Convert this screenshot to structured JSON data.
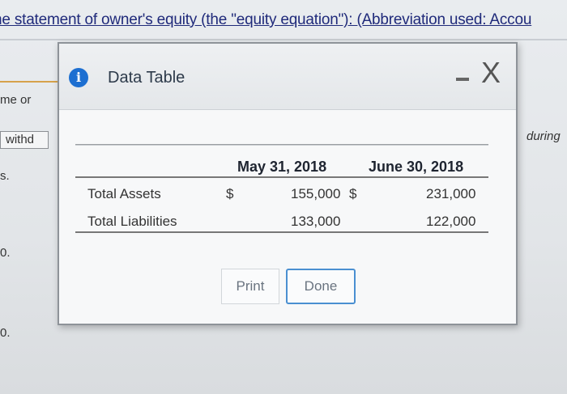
{
  "background": {
    "heading": "he statement of owner's equity (the \"equity equation\"): (Abbreviation used: Accou",
    "fragments": [
      "me or",
      "withd",
      "s.",
      "0.",
      "0."
    ],
    "right_fragment": "during"
  },
  "dialog": {
    "title": "Data Table",
    "info_icon": "i",
    "minimize_label": "-",
    "close_label": "X",
    "table": {
      "columns": [
        "May 31, 2018",
        "June 30, 2018"
      ],
      "rows": [
        {
          "label": "Total Assets",
          "c1_prefix": "$",
          "c1_value": "155,000",
          "c2_prefix": "$",
          "c2_value": "231,000"
        },
        {
          "label": "Total Liabilities",
          "c1_prefix": "",
          "c1_value": "133,000",
          "c2_prefix": "",
          "c2_value": "122,000"
        }
      ]
    },
    "buttons": {
      "print": "Print",
      "done": "Done"
    }
  }
}
